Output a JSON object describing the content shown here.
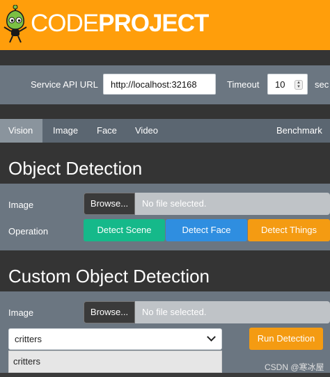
{
  "header": {
    "brand_light": "CODE",
    "brand_bold": "PROJECT",
    "mascot_icon": "codeproject-bob-mascot-icon",
    "background": "#ff9e0b"
  },
  "service": {
    "api_url_label": "Service API URL",
    "api_url_value": "http://localhost:32168",
    "timeout_label": "Timeout",
    "timeout_value": "10",
    "timeout_unit": "sec"
  },
  "tabs": [
    {
      "label": "Vision",
      "active": true
    },
    {
      "label": "Image",
      "active": false
    },
    {
      "label": "Face",
      "active": false
    },
    {
      "label": "Video",
      "active": false
    },
    {
      "label": "Benchmark",
      "active": false
    }
  ],
  "object_detection": {
    "title": "Object Detection",
    "image_label": "Image",
    "browse_label": "Browse...",
    "file_status": "No file selected.",
    "operation_label": "Operation",
    "buttons": {
      "scene": "Detect Scene",
      "face": "Detect Face",
      "things": "Detect Things"
    }
  },
  "custom_detection": {
    "title": "Custom Object Detection",
    "image_label": "Image",
    "browse_label": "Browse...",
    "file_status": "No file selected.",
    "model_selected": "critters",
    "dropdown_options": [
      "critters"
    ],
    "run_label": "Run Detection"
  },
  "watermark": "CSDN @寒冰屋",
  "colors": {
    "accent_orange": "#f49b12",
    "scene_green": "#15b98a",
    "face_blue": "#2f8ee0",
    "panel_gray": "#6b7681",
    "dark_strip": "#343434"
  }
}
